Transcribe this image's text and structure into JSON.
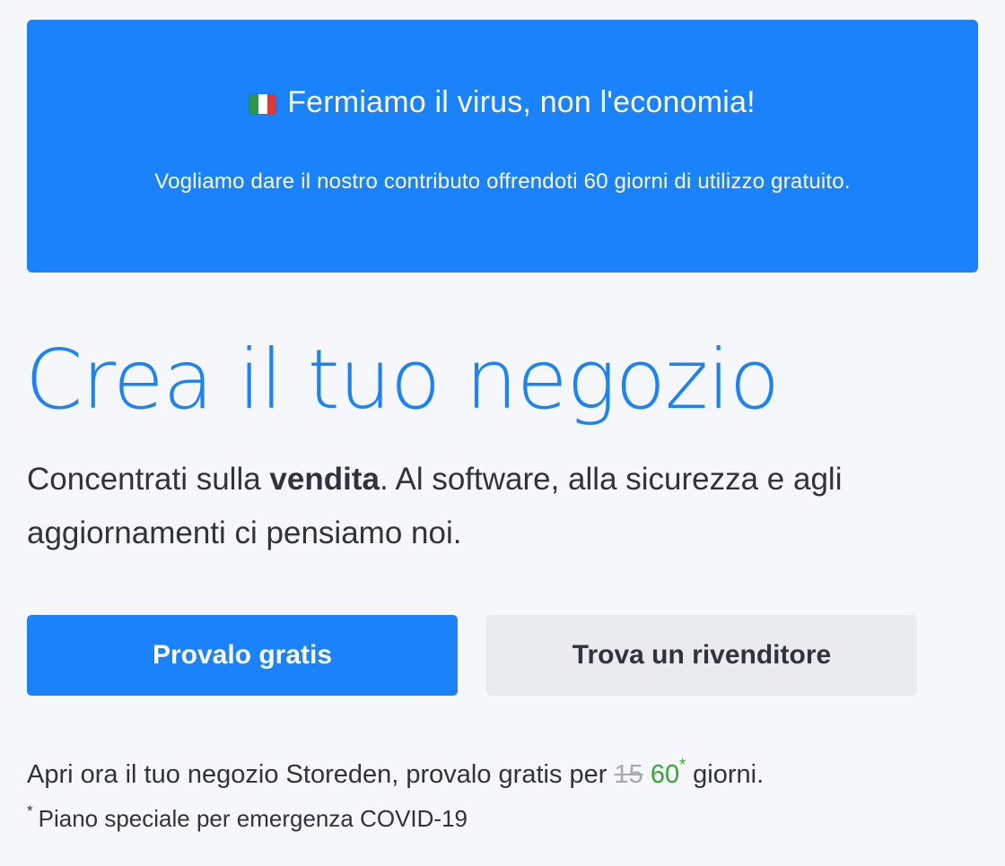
{
  "banner": {
    "title": "Fermiamo il virus, non l'economia!",
    "text": "Vogliamo dare il nostro contributo offrendoti 60 giorni di utilizzo gratuito.",
    "flag_icon": "italian-flag-icon",
    "background_color": "#1a82fb"
  },
  "hero": {
    "title": "Crea il tuo negozio",
    "subtitle_part1": "Concentrati sulla ",
    "subtitle_bold": "vendita",
    "subtitle_part2": ". Al software, alla sicurezza e agli aggiornamenti ci pensiamo noi."
  },
  "buttons": {
    "primary_label": "Provalo gratis",
    "secondary_label": "Trova un rivenditore"
  },
  "trial": {
    "text_before": "Apri ora il tuo negozio Storeden, provalo gratis per ",
    "old_days": "15",
    "new_days": "60",
    "asterisk": "*",
    "text_after": " giorni."
  },
  "note": {
    "asterisk": "*",
    "text": "Piano speciale per emergenza COVID-19"
  },
  "colors": {
    "accent": "#1a82fb",
    "green": "#33a92f",
    "muted": "#a5a9af",
    "secondary_button": "#e9ebef"
  }
}
